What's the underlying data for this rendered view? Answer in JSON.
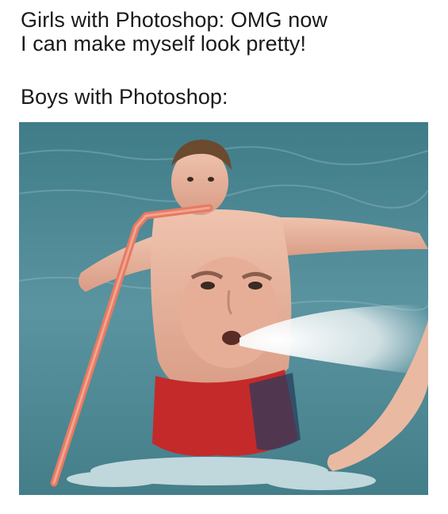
{
  "caption_top": {
    "line1": "Girls with Photoshop: OMG now",
    "line2": "I can make myself look pretty!"
  },
  "caption_bottom": "Boys with Photoshop:",
  "photo": {
    "description_icon": "meme-photo",
    "colors": {
      "water": "#4f8a94",
      "skin": "#e8b9a4",
      "shorts": "#c42a2a",
      "straw": "#e77a62",
      "spray": "#f2f4f5"
    }
  }
}
